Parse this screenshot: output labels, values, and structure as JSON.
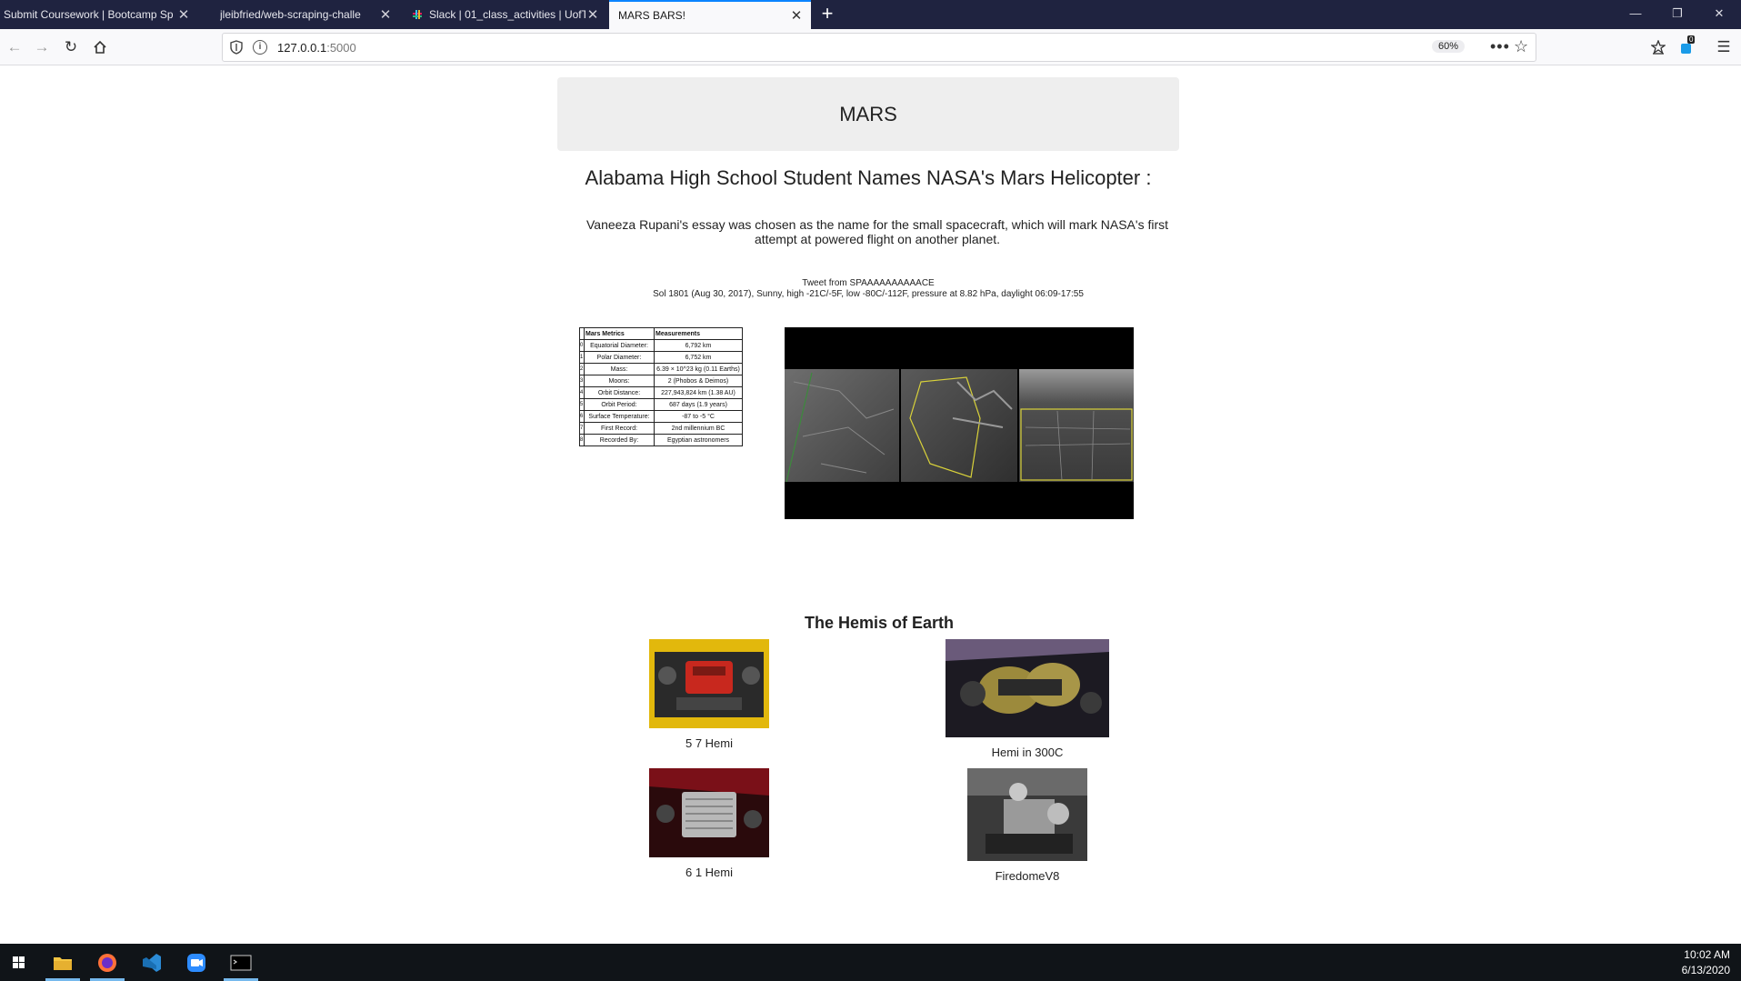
{
  "browser": {
    "tabs": [
      {
        "title": "Submit Coursework | Bootcamp Sp",
        "active": false
      },
      {
        "title": "jleibfried/web-scraping-challe",
        "active": false
      },
      {
        "title": "Slack | 01_class_activities | UofT",
        "active": false
      },
      {
        "title": "MARS BARS!",
        "active": true
      }
    ],
    "new_tab": "+",
    "window_controls": [
      "—",
      "❐",
      "✕"
    ],
    "url_host": "127.0.0.1",
    "url_port": ":5000",
    "zoom": "60%",
    "page_actions": "•••",
    "bookmark_star": "☆",
    "notification_count": "0"
  },
  "page": {
    "jumbotron_title": "MARS",
    "news_title": "Alabama High School Student Names NASA's Mars Helicopter :",
    "news_paragraph": "Vaneeza Rupani's essay was chosen as the name for the small spacecraft, which will mark NASA's first attempt at powered flight on another planet.",
    "tweet_heading": "Tweet from SPAAAAAAAAAACE",
    "tweet_text": "Sol 1801 (Aug 30, 2017), Sunny, high -21C/-5F, low -80C/-112F, pressure at 8.82 hPa, daylight 06:09-17:55",
    "facts_headers": [
      "Mars Metrics",
      "Measurements"
    ],
    "facts": [
      {
        "i": "0",
        "k": "Equatorial Diameter:",
        "v": "6,792 km"
      },
      {
        "i": "1",
        "k": "Polar Diameter:",
        "v": "6,752 km"
      },
      {
        "i": "2",
        "k": "Mass:",
        "v": "6.39 × 10^23 kg (0.11 Earths)"
      },
      {
        "i": "3",
        "k": "Moons:",
        "v": "2 (Phobos & Deimos)"
      },
      {
        "i": "4",
        "k": "Orbit Distance:",
        "v": "227,943,824 km (1.38 AU)"
      },
      {
        "i": "5",
        "k": "Orbit Period:",
        "v": "687 days (1.9 years)"
      },
      {
        "i": "6",
        "k": "Surface Temperature:",
        "v": "-87 to -5 °C"
      },
      {
        "i": "7",
        "k": "First Record:",
        "v": "2nd millennium BC"
      },
      {
        "i": "8",
        "k": "Recorded By:",
        "v": "Egyptian astronomers"
      }
    ],
    "hemis_title": "The Hemis of Earth",
    "hemis": [
      {
        "caption": "5 7 Hemi"
      },
      {
        "caption": "Hemi in 300C"
      },
      {
        "caption": "6 1 Hemi"
      },
      {
        "caption": "FiredomeV8"
      }
    ]
  },
  "taskbar": {
    "time": "10:02 AM",
    "date": "6/13/2020"
  }
}
